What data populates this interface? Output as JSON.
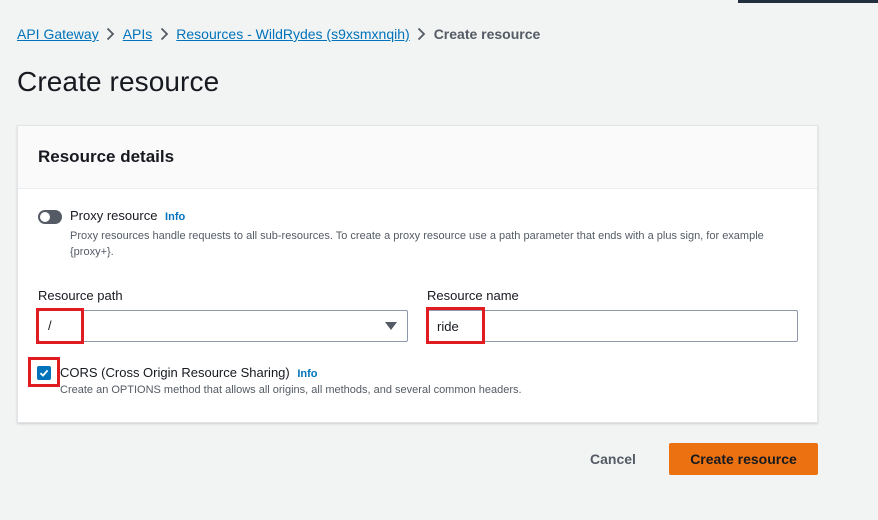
{
  "breadcrumb": {
    "items": [
      {
        "label": "API Gateway"
      },
      {
        "label": "APIs"
      },
      {
        "label": "Resources - WildRydes (s9xsmxnqih)"
      }
    ],
    "current": "Create resource"
  },
  "page_title": "Create resource",
  "panel": {
    "title": "Resource details",
    "proxy": {
      "label": "Proxy resource",
      "info": "Info",
      "enabled": false,
      "description": "Proxy resources handle requests to all sub-resources. To create a proxy resource use a path parameter that ends with a plus sign, for example {proxy+}."
    },
    "resource_path": {
      "label": "Resource path",
      "value": "/"
    },
    "resource_name": {
      "label": "Resource name",
      "value": "ride"
    },
    "cors": {
      "label": "CORS (Cross Origin Resource Sharing)",
      "info": "Info",
      "checked": true,
      "description": "Create an OPTIONS method that allows all origins, all methods, and several common headers."
    }
  },
  "actions": {
    "cancel_label": "Cancel",
    "create_label": "Create resource"
  },
  "colors": {
    "accent": "#0073bb",
    "primary_button": "#ec7211",
    "highlight": "#e11b22"
  }
}
